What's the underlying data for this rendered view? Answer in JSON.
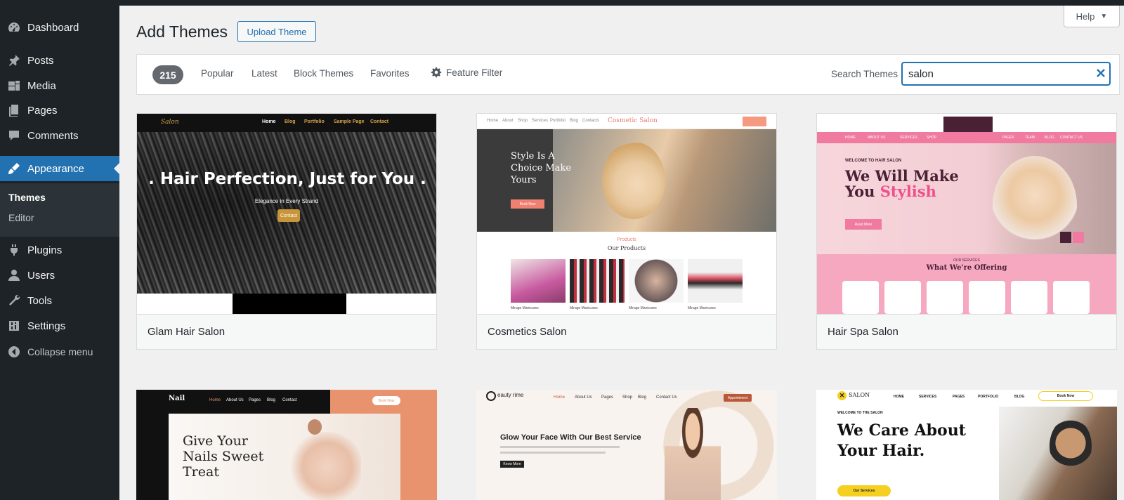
{
  "sidebar": {
    "items": [
      {
        "label": "Dashboard",
        "icon": "dashboard-icon"
      },
      {
        "label": "Posts",
        "icon": "pin-icon"
      },
      {
        "label": "Media",
        "icon": "media-icon"
      },
      {
        "label": "Pages",
        "icon": "pages-icon"
      },
      {
        "label": "Comments",
        "icon": "comments-icon"
      },
      {
        "label": "Appearance",
        "icon": "appearance-icon"
      },
      {
        "label": "Plugins",
        "icon": "plugins-icon"
      },
      {
        "label": "Users",
        "icon": "users-icon"
      },
      {
        "label": "Tools",
        "icon": "tools-icon"
      },
      {
        "label": "Settings",
        "icon": "settings-icon"
      }
    ],
    "submenu": [
      "Themes",
      "Editor"
    ],
    "collapse": "Collapse menu"
  },
  "header": {
    "title": "Add Themes",
    "upload": "Upload Theme",
    "help": "Help"
  },
  "filter": {
    "count": "215",
    "links": [
      "Popular",
      "Latest",
      "Block Themes",
      "Favorites"
    ],
    "feature_filter": "Feature Filter",
    "search_label": "Search Themes",
    "search_value": "salon"
  },
  "themes": [
    {
      "name": "Glam Hair Salon",
      "nav": [
        "Home",
        "Blog",
        "Portfolio",
        "Sample Page",
        "Contact"
      ],
      "logo": "Salon",
      "headline": ". Hair Perfection, Just for You .",
      "subline": "Elegance in Every Strand",
      "cta": "Contact"
    },
    {
      "name": "Cosmetics Salon",
      "nav": [
        "Home",
        "About",
        "Shop",
        "Services",
        "Portfolio",
        "Blog",
        "Contacts"
      ],
      "logo": "Cosmetic Salon",
      "headline": "Style Is A Choice Make Yours",
      "cta": "Book Now",
      "section_kicker": "Products",
      "section_title": "Our Products",
      "product_label": "Mirage Manicures"
    },
    {
      "name": "Hair Spa Salon",
      "nav": [
        "HOME",
        "ABOUT US",
        "SERVICES",
        "SHOP",
        "PAGES",
        "TEAM",
        "BLOG",
        "CONTACT US"
      ],
      "kicker": "WELCOME TO HAIR SALON",
      "headline_1": "We Will Make",
      "headline_2a": "You ",
      "headline_2b": "Stylish",
      "cta": "Read More",
      "section_kicker": "OUR SERVICES",
      "section_title": "What We're Offering"
    },
    {
      "nav": [
        "Home",
        "About Us",
        "Pages",
        "Blog",
        "Contact"
      ],
      "logo": "Nail",
      "headline": "Give Your Nails Sweet Treat",
      "cta": "Book Now"
    },
    {
      "nav": [
        "Home",
        "About Us",
        "Pages",
        "Shop",
        "Blog",
        "Contact Us"
      ],
      "logo": "eauty rime",
      "headline": "Glow Your Face With Our Best Service",
      "cta": "Appointment",
      "cta2": "Know More"
    },
    {
      "nav": [
        "HOME",
        "SERVICES",
        "PAGES",
        "PORTFOLIO",
        "BLOG"
      ],
      "logo": "SALON",
      "kicker": "WELCOME TO THE SALON",
      "headline": "We Care About Your Hair.",
      "cta": "Book Now",
      "cta2": "Our Services"
    }
  ],
  "colors": {
    "sidebar": "#1d2327",
    "accent": "#2271b1",
    "background": "#f0f0f1"
  }
}
